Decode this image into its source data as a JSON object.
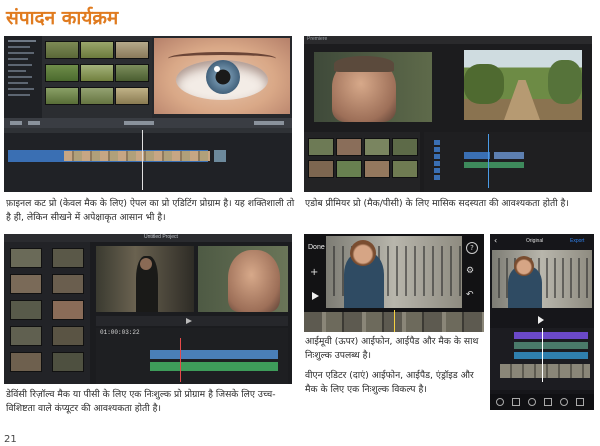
{
  "page": {
    "heading": "संपादन कार्यक्रम",
    "page_number": "21"
  },
  "captions": {
    "final_cut": "फ़ाइनल कट प्रो (केवल मैक के लिए) ऐपल का प्रो एडिटिंग प्रोग्राम है। यह शक्तिशाली तो है ही, लेकिन सीखने में अपेक्षाकृत आसान भी है।",
    "premiere": "एडोब प्रीमियर प्रो (मैक/पीसी) के लिए मासिक सदस्यता की आवश्यकता होती है।",
    "resolve": "डेविंसी रिज़ॉल्व मैक या पीसी के लिए एक निःशुल्क प्रो प्रोग्राम है जिसके लिए उच्च-विशिष्टता वाले कंप्यूटर की आवश्यकता होती है।",
    "imovie": "आईमूवी (ऊपर) आईफोन, आईपैड और मैक के साथ निःशुल्क उपलब्ध है।",
    "vn": "वीएन एडिटर (दाएं) आईफोन, आईपैड, एंड्रॉइड और मैक के लिए एक निःशुल्क विकल्प है।"
  },
  "screens": {
    "premiere": {
      "app_label": "Premiere"
    },
    "resolve": {
      "app_label": "Untitled Project",
      "timecode": "01:00:03:22"
    },
    "imovie": {
      "done_label": "Done"
    },
    "vn": {
      "ratio_label": "Original",
      "export_label": "Export"
    }
  },
  "icons": {
    "imovie_info": "info-icon",
    "imovie_plus": "plus-icon",
    "imovie_play": "play-icon",
    "imovie_settings": "gear-icon",
    "imovie_undo": "undo-icon",
    "vn_back": "chevron-left-icon",
    "vn_play": "play-icon"
  },
  "colors": {
    "heading": "#e07b1f",
    "fcp_timeline_clip": "#3a6fb3",
    "resolve_audio_green": "#3e9c5a",
    "resolve_video_blue": "#4a7fb8",
    "vn_track_purple": "#6b49c9",
    "vn_export": "#2f80ed"
  }
}
